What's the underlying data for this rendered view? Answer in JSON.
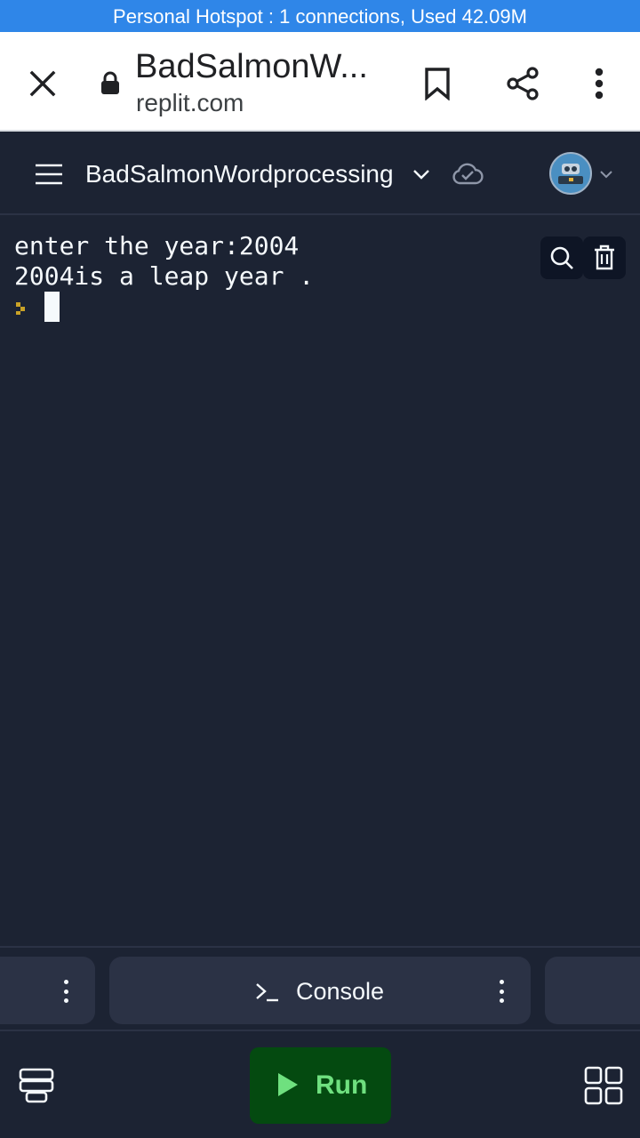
{
  "status_bar": {
    "text": "Personal Hotspot : 1 connections, Used 42.09M"
  },
  "browser": {
    "page_title": "BadSalmonW...",
    "url": "replit.com",
    "close_icon": "close-icon",
    "lock_icon": "lock-icon",
    "bookmark_icon": "bookmark-icon",
    "share_icon": "share-icon",
    "menu_icon": "more-vert-icon"
  },
  "app_header": {
    "repl_name": "BadSalmonWordprocessing",
    "menu_icon": "hamburger-icon",
    "dropdown_icon": "chevron-down-icon",
    "sync_icon": "cloud-check-icon",
    "avatar_icon": "avatar"
  },
  "console": {
    "lines": [
      "enter the year:2004",
      "2004is a leap year ."
    ],
    "search_icon": "search-icon",
    "clear_icon": "trash-icon"
  },
  "tabs": {
    "active_label": "Console",
    "active_icon": "terminal-icon"
  },
  "bottom": {
    "run_label": "Run",
    "left_icon": "layers-icon",
    "right_icon": "grid-icon"
  },
  "colors": {
    "status_bar": "#2f86e8",
    "background": "#1c2333",
    "surface": "#2b3245",
    "run_bg": "#044a10",
    "run_fg": "#6fe07f",
    "prompt": "#c9a227"
  }
}
